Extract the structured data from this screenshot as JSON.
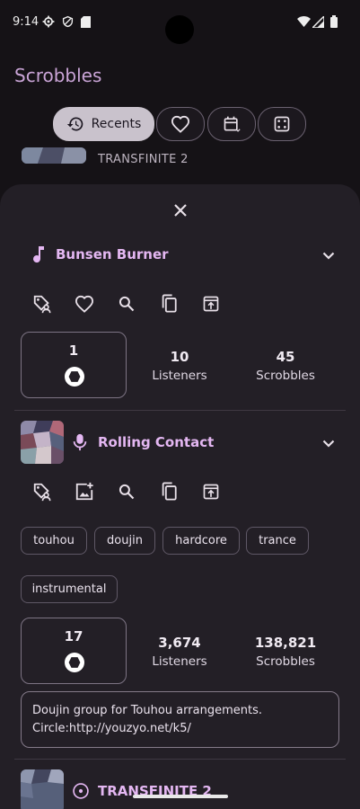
{
  "status_bar": {
    "time": "9:14"
  },
  "app": {
    "title": "Scrobbles"
  },
  "tabs": {
    "recents_label": "Recents"
  },
  "peek": {
    "subtitle": "TRANSFINITE 2"
  },
  "track": {
    "title": "Bunsen Burner",
    "stats": {
      "rank": "1",
      "listeners": "10",
      "listeners_label": "Listeners",
      "scrobbles": "45",
      "scrobbles_label": "Scrobbles"
    }
  },
  "artist": {
    "title": "Rolling Contact",
    "tags": [
      "touhou",
      "doujin",
      "hardcore",
      "trance",
      "instrumental"
    ],
    "stats": {
      "rank": "17",
      "listeners": "3,674",
      "listeners_label": "Listeners",
      "scrobbles": "138,821",
      "scrobbles_label": "Scrobbles"
    },
    "description_line1": "Doujin group for Touhou arrangements.",
    "description_line2": "Circle:http://youzyo.net/k5/"
  },
  "album_peek": {
    "title": "TRANSFINITE 2"
  },
  "colors": {
    "accent": "#e4b7f2",
    "background": "#151216",
    "sheet": "#231f26"
  }
}
